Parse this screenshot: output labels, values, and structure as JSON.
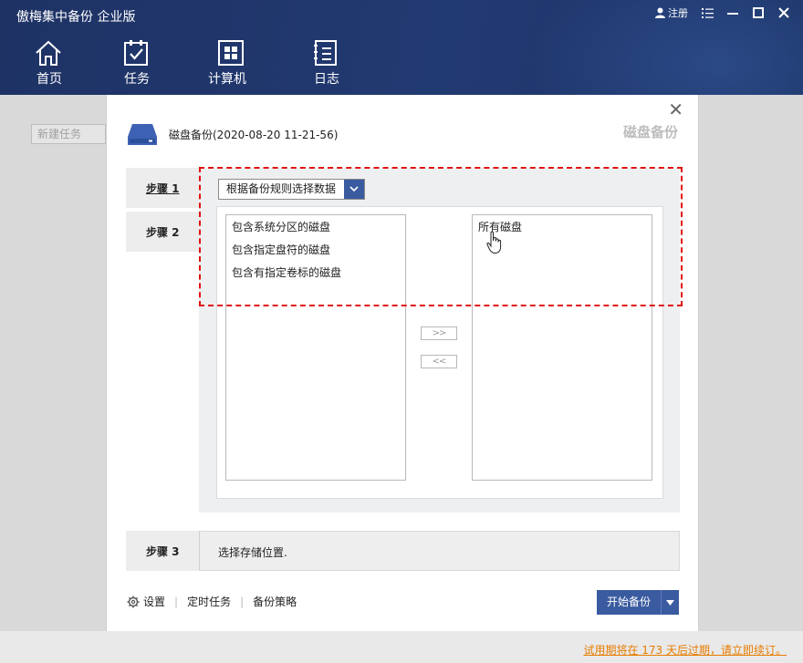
{
  "app": {
    "title": "傲梅集中备份 企业版",
    "register_label": "注册"
  },
  "nav": [
    {
      "label": "首页",
      "icon": "home-icon"
    },
    {
      "label": "任务",
      "icon": "task-icon"
    },
    {
      "label": "计算机",
      "icon": "computer-icon"
    },
    {
      "label": "日志",
      "icon": "log-icon"
    }
  ],
  "background": {
    "new_task_label": "新建任务"
  },
  "dialog": {
    "title": "磁盘备份(2020-08-20 11-21-56)",
    "subtitle": "磁盘备份",
    "steps": {
      "step1": "步骤 1",
      "step2": "步骤 2",
      "step3": "步骤 3"
    },
    "rule_select_value": "根据备份规则选择数据",
    "left_list": [
      "包含系统分区的磁盘",
      "包含指定盘符的磁盘",
      "包含有指定卷标的磁盘"
    ],
    "right_list": [
      "所有磁盘"
    ],
    "add_button": ">>",
    "remove_button": "<<",
    "step3_text": "选择存储位置.",
    "footer": {
      "settings": "设置",
      "schedule": "定时任务",
      "strategy": "备份策略",
      "start": "开始备份"
    }
  },
  "trial_notice": "试用期将在 173 天后过期，请立即续订。",
  "colors": {
    "header_bg": "#1e3264",
    "accent_blue": "#3a5ba0",
    "highlight_dash": "#e01010",
    "trial_orange": "#e87c00"
  }
}
